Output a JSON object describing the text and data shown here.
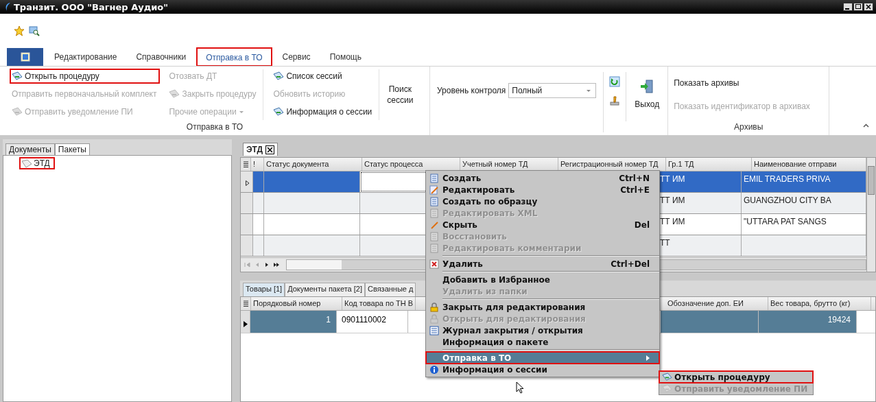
{
  "window": {
    "title": "Транзит. ООО \"Вагнер Аудио\""
  },
  "ribbon": {
    "tabs": [
      {
        "label": "Редактирование",
        "selected": false,
        "highlighted": false
      },
      {
        "label": "Справочники",
        "selected": false,
        "highlighted": false
      },
      {
        "label": "Отправка в ТО",
        "selected": true,
        "highlighted": true
      },
      {
        "label": "Сервис",
        "selected": false,
        "highlighted": false
      },
      {
        "label": "Помощь",
        "selected": false,
        "highlighted": false
      }
    ],
    "send_group": {
      "caption": "Отправка в ТО",
      "columns": [
        [
          {
            "label": "Открыть процедуру",
            "kind": "button",
            "disabled": false,
            "highlighted": true
          },
          {
            "label": "Отправить первоначальный комплект",
            "kind": "button",
            "disabled": true,
            "highlighted": false
          },
          {
            "label": "Отправить уведомление ПИ",
            "kind": "button",
            "disabled": true,
            "highlighted": false
          }
        ],
        [
          {
            "label": "Отозвать ДТ",
            "kind": "button",
            "disabled": true,
            "highlighted": false
          },
          {
            "label": "Закрыть процедуру",
            "kind": "button",
            "disabled": true,
            "highlighted": false
          },
          {
            "label": "Прочие операции",
            "kind": "dropdown",
            "disabled": true,
            "highlighted": false
          }
        ],
        [
          {
            "label": "Список сессий",
            "kind": "button",
            "disabled": false,
            "highlighted": false
          },
          {
            "label": "Обновить историю",
            "kind": "button",
            "disabled": true,
            "highlighted": false
          },
          {
            "label": "Информация о сессии",
            "kind": "button",
            "disabled": false,
            "highlighted": false
          }
        ]
      ],
      "search_button": "Поиск сессии"
    },
    "control": {
      "label": "Уровень контроля",
      "value": "Полный",
      "exit_button": "Выход"
    },
    "archives": {
      "caption": "Архивы",
      "buttons": [
        {
          "label": "Показать архивы",
          "disabled": false
        },
        {
          "label": "Показать идентификатор в архивах",
          "disabled": true
        }
      ]
    }
  },
  "left_panel": {
    "tabs": [
      {
        "label": "Документы",
        "selected": false
      },
      {
        "label": "Пакеты",
        "selected": true
      }
    ],
    "tree": [
      {
        "label": "ЭТД",
        "highlighted": true
      }
    ]
  },
  "document_tabs": [
    {
      "label": "ЭТД",
      "selected": true
    }
  ],
  "main_grid": {
    "columns": [
      {
        "label": "!"
      },
      {
        "label": "Статус документа"
      },
      {
        "label": "Статус процесса"
      },
      {
        "label": "Учетный номер ТД"
      },
      {
        "label": "Регистрационный номер ТД"
      },
      {
        "label": "Гр.1 ТД"
      },
      {
        "label": "Наименование отправи"
      }
    ],
    "rows": [
      {
        "selected": true,
        "gr1": "ТТ  ИМ",
        "sender": "EMIL TRADERS PRIVA"
      },
      {
        "selected": false,
        "gr1": "ТТ  ИМ",
        "sender": "GUANGZHOU CITY BA"
      },
      {
        "selected": false,
        "gr1": "ТТ  ИМ",
        "sender": "\"UTTARA PAT SANGS"
      },
      {
        "selected": false,
        "gr1": "ТТ"
      }
    ]
  },
  "bottom_tabs": [
    {
      "label": "Товары [1]",
      "selected": true
    },
    {
      "label": "Документы пакета [2]",
      "selected": false
    },
    {
      "label": "Связанные д",
      "selected": false
    }
  ],
  "bottom_grid": {
    "columns": [
      {
        "label": "Порядковый номер"
      },
      {
        "label": "Код товара по ТН В"
      },
      {
        "label": "Обозначение доп. ЕИ"
      },
      {
        "label": "Вес товара, брутто (кг)"
      }
    ],
    "rows": [
      {
        "selected": true,
        "number": "1",
        "code": "0901110002",
        "weight": "19424"
      }
    ]
  },
  "context_menu": [
    {
      "kind": "item",
      "label": "Создать",
      "shortcut": "Ctrl+N",
      "disabled": false,
      "selected": false,
      "highlighted": false
    },
    {
      "kind": "item",
      "label": "Редактировать",
      "shortcut": "Ctrl+E",
      "disabled": false,
      "selected": false,
      "highlighted": false
    },
    {
      "kind": "item",
      "label": "Создать по образцу",
      "disabled": false,
      "selected": false,
      "highlighted": false
    },
    {
      "kind": "item",
      "label": "Редактировать XML",
      "disabled": true,
      "selected": false,
      "highlighted": false
    },
    {
      "kind": "item",
      "label": "Скрыть",
      "shortcut": "Del",
      "disabled": false,
      "selected": false,
      "highlighted": false
    },
    {
      "kind": "item",
      "label": "Восстановить",
      "disabled": true,
      "selected": false,
      "highlighted": false
    },
    {
      "kind": "item",
      "label": "Редактировать комментарии",
      "disabled": true,
      "selected": false,
      "highlighted": false
    },
    {
      "kind": "separator"
    },
    {
      "kind": "item",
      "label": "Удалить",
      "shortcut": "Ctrl+Del",
      "disabled": false,
      "selected": false,
      "highlighted": false
    },
    {
      "kind": "separator"
    },
    {
      "kind": "item",
      "label": "Добавить в Избранное",
      "disabled": false,
      "selected": false,
      "highlighted": false
    },
    {
      "kind": "item",
      "label": "Удалить из папки",
      "disabled": true,
      "selected": false,
      "highlighted": false
    },
    {
      "kind": "separator"
    },
    {
      "kind": "item",
      "label": "Закрыть для редактирования",
      "disabled": false,
      "selected": false,
      "highlighted": false
    },
    {
      "kind": "item",
      "label": "Открыть для редактирования",
      "disabled": true,
      "selected": false,
      "highlighted": false
    },
    {
      "kind": "item",
      "label": "Журнал закрытия / открытия",
      "disabled": false,
      "selected": false,
      "highlighted": false
    },
    {
      "kind": "item",
      "label": "Информация о пакете",
      "disabled": false,
      "selected": false,
      "highlighted": false
    },
    {
      "kind": "separator"
    },
    {
      "kind": "item",
      "label": "Отправка в ТО",
      "disabled": false,
      "selected": true,
      "highlighted": true,
      "children": [
        {
          "label": "Открыть процедуру",
          "disabled": false,
          "highlighted": true
        },
        {
          "label": "Отправить уведомление ПИ",
          "disabled": true,
          "highlighted": false
        }
      ]
    },
    {
      "kind": "item",
      "label": "Информация о сессии",
      "disabled": false,
      "selected": false,
      "highlighted": false
    }
  ]
}
